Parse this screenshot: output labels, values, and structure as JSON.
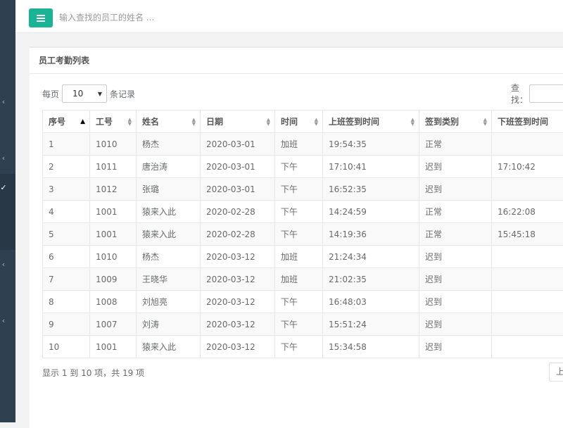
{
  "topbar": {
    "menu_icon": "hamburger-icon",
    "search_placeholder": "输入查找的员工的姓名 ..."
  },
  "sidebar": {
    "chevrons": [
      "‹",
      "‹",
      "✓",
      "‹",
      "‹"
    ]
  },
  "panel": {
    "title": "员工考勤列表",
    "length_prefix": "每页",
    "length_value": "10",
    "length_suffix": "条记录",
    "filter_label": "查找：",
    "info": "显示 1 到 10 项，共 19 项",
    "prev_label": "上"
  },
  "table": {
    "columns": [
      "序号",
      "工号",
      "姓名",
      "日期",
      "时间",
      "上班签到时间",
      "签到类别",
      "下班签到时间"
    ],
    "rows": [
      [
        "1",
        "1010",
        "杨杰",
        "2020-03-01",
        "加班",
        "19:54:35",
        "正常",
        ""
      ],
      [
        "2",
        "1011",
        "唐治涛",
        "2020-03-01",
        "下午",
        "17:10:41",
        "迟到",
        "17:10:42"
      ],
      [
        "3",
        "1012",
        "张璐",
        "2020-03-01",
        "下午",
        "16:52:35",
        "迟到",
        ""
      ],
      [
        "4",
        "1001",
        "猿来入此",
        "2020-02-28",
        "下午",
        "14:24:59",
        "正常",
        "16:22:08"
      ],
      [
        "5",
        "1001",
        "猿来入此",
        "2020-02-28",
        "下午",
        "14:19:36",
        "正常",
        "15:45:18"
      ],
      [
        "6",
        "1010",
        "杨杰",
        "2020-03-12",
        "加班",
        "21:24:34",
        "迟到",
        ""
      ],
      [
        "7",
        "1009",
        "王晓华",
        "2020-03-12",
        "加班",
        "21:02:35",
        "迟到",
        ""
      ],
      [
        "8",
        "1008",
        "刘旭亮",
        "2020-03-12",
        "下午",
        "16:48:03",
        "迟到",
        ""
      ],
      [
        "9",
        "1007",
        "刘涛",
        "2020-03-12",
        "下午",
        "15:51:24",
        "迟到",
        ""
      ],
      [
        "10",
        "1001",
        "猿来入此",
        "2020-03-12",
        "下午",
        "15:34:58",
        "迟到",
        ""
      ]
    ]
  },
  "colors": {
    "accent": "#1ab394",
    "sidebar": "#2f4050"
  }
}
